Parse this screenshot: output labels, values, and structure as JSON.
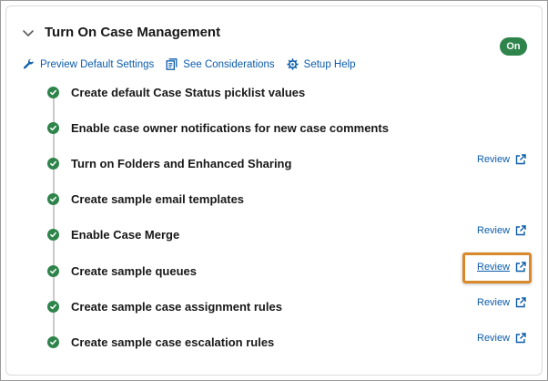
{
  "header": {
    "title": "Turn On Case Management",
    "toggle_label": "On"
  },
  "links": [
    {
      "label": "Preview Default Settings",
      "icon": "wrench-icon"
    },
    {
      "label": "See Considerations",
      "icon": "document-icon"
    },
    {
      "label": "Setup Help",
      "icon": "gear-icon"
    }
  ],
  "steps": [
    {
      "label": "Create default Case Status picklist values"
    },
    {
      "label": "Enable case owner notifications for new case comments"
    },
    {
      "label": "Turn on Folders and Enhanced Sharing",
      "review": "Review"
    },
    {
      "label": "Create sample email templates"
    },
    {
      "label": "Enable Case Merge",
      "review": "Review"
    },
    {
      "label": "Create sample queues",
      "review": "Review",
      "highlighted": true
    },
    {
      "label": "Create sample case assignment rules",
      "review": "Review"
    },
    {
      "label": "Create sample case escalation rules",
      "review": "Review"
    }
  ],
  "colors": {
    "success": "#2e844a",
    "link": "#0b5cab",
    "highlight": "#d88a2b"
  }
}
